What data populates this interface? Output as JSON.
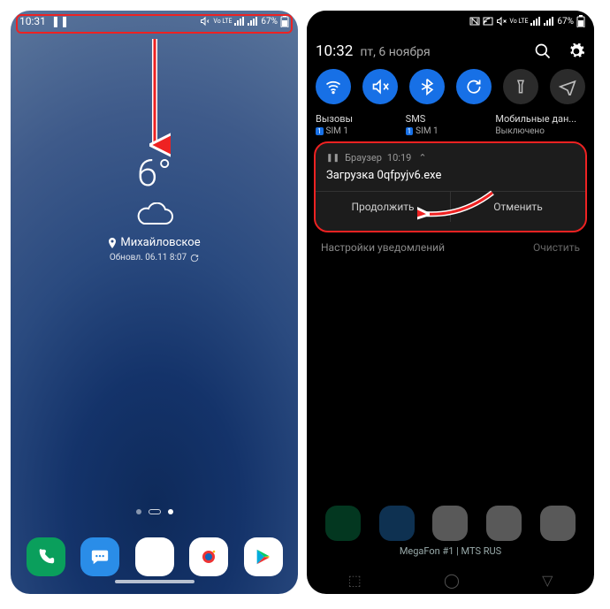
{
  "left": {
    "statusbar": {
      "time": "10:31",
      "battery_pct": "67%",
      "network_label": "Vo LTE"
    },
    "weather": {
      "temperature": "6°",
      "location": "Михайловское",
      "updated": "Обновл. 06.11 8:07"
    }
  },
  "right": {
    "statusbar": {
      "battery_pct": "67%",
      "network_label": "Vo LTE"
    },
    "shade": {
      "time": "10:32",
      "date": "пт, 6 ноября"
    },
    "sim": {
      "calls_label": "Вызовы",
      "calls_value": "SIM 1",
      "sms_label": "SMS",
      "sms_value": "SIM 1",
      "data_label": "Мобильные дан...",
      "data_value": "Выключено"
    },
    "notif": {
      "app": "Браузер",
      "time": "10:19",
      "title": "Загрузка 0qfpyjv6.exe",
      "continue": "Продолжить",
      "cancel": "Отменить"
    },
    "footer": {
      "settings": "Настройки уведомлений",
      "clear": "Очистить"
    },
    "carrier": "MegaFon #1 | MTS RUS"
  },
  "sim_badge": "1"
}
